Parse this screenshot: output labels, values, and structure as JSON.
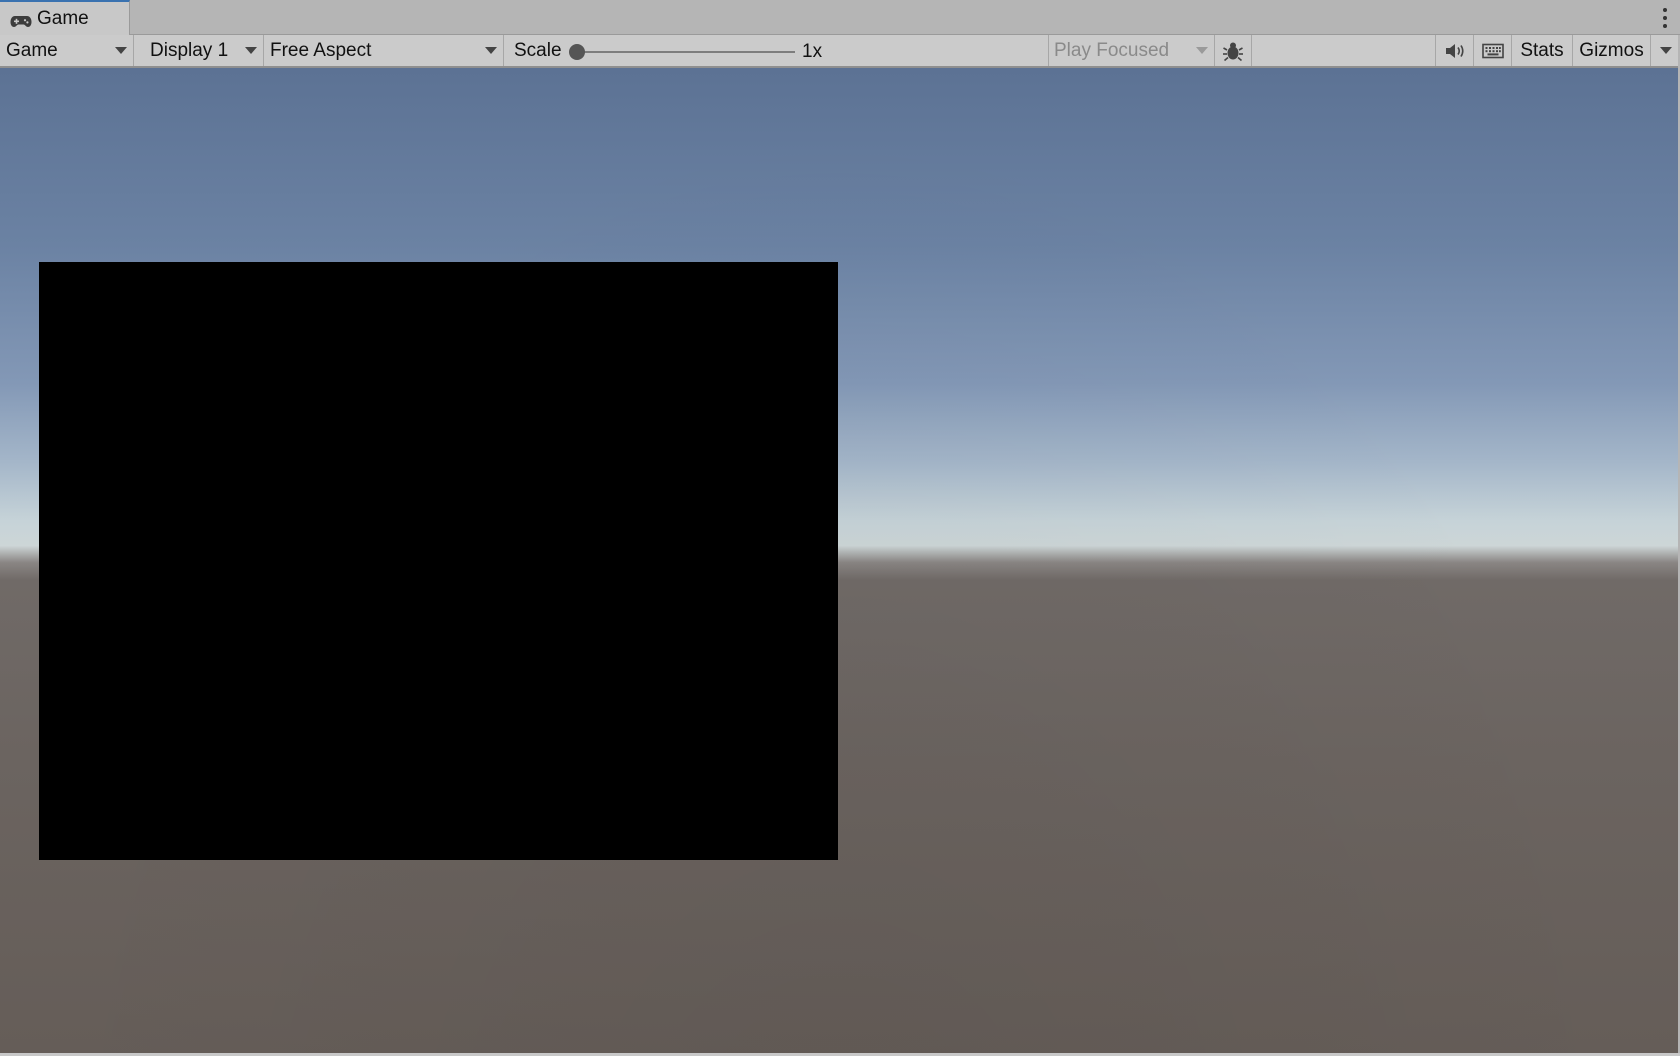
{
  "tab": {
    "label": "Game",
    "icon": "gamepad-icon",
    "accent_color": "#3a72b0"
  },
  "toolbar": {
    "view_mode": "Game",
    "display": "Display 1",
    "aspect": "Free Aspect",
    "scale_label": "Scale",
    "scale_value": "1x",
    "scale_level": 0,
    "play_mode": "Play Focused",
    "debug_icon": "bug-icon",
    "audio_icon": "speaker-icon",
    "keyboard_icon": "keyboard-icon",
    "stats_label": "Stats",
    "gizmos_label": "Gizmos",
    "more_icon": "kebab-menu-icon"
  }
}
